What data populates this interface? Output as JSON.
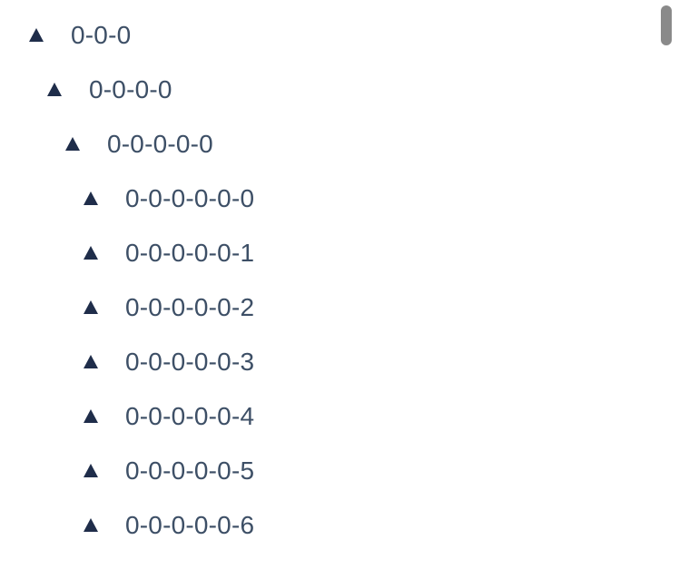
{
  "tree": {
    "nodes": [
      {
        "label": "0-0-0",
        "expanded": true,
        "depth": 0
      },
      {
        "label": "0-0-0-0",
        "expanded": true,
        "depth": 1
      },
      {
        "label": "0-0-0-0-0",
        "expanded": true,
        "depth": 2
      },
      {
        "label": "0-0-0-0-0-0",
        "expanded": true,
        "depth": 3
      },
      {
        "label": "0-0-0-0-0-1",
        "expanded": true,
        "depth": 3
      },
      {
        "label": "0-0-0-0-0-2",
        "expanded": true,
        "depth": 3
      },
      {
        "label": "0-0-0-0-0-3",
        "expanded": true,
        "depth": 3
      },
      {
        "label": "0-0-0-0-0-4",
        "expanded": true,
        "depth": 3
      },
      {
        "label": "0-0-0-0-0-5",
        "expanded": true,
        "depth": 3
      },
      {
        "label": "0-0-0-0-0-6",
        "expanded": true,
        "depth": 3
      }
    ],
    "switcher_icon": "caret-up-icon"
  },
  "colors": {
    "icon": "#1f2d4a",
    "text": "#3d4f66",
    "scrollbar": "#8a8a8a"
  }
}
